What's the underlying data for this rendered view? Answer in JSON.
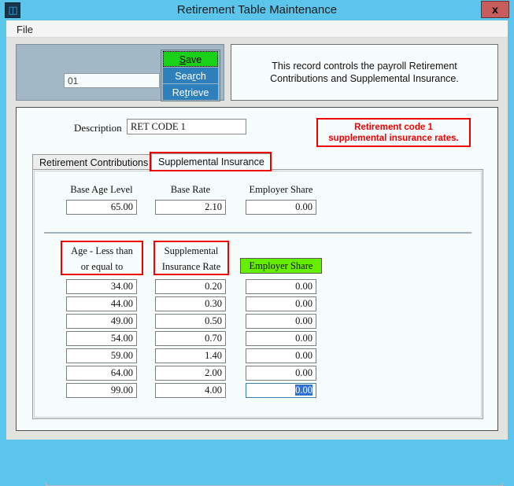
{
  "window": {
    "title": "Retirement Table Maintenance",
    "icon": "database-icon",
    "close_label": "x",
    "titlebar_color": "#5bc5ec"
  },
  "menubar": {
    "items": [
      {
        "label": "File"
      }
    ]
  },
  "toolbar": {
    "code_value": "01",
    "buttons": [
      {
        "label": "Save",
        "accel": "S",
        "color": "#18d118",
        "focused": true
      },
      {
        "label": "Search",
        "accel": "r",
        "color": "#2e80bd",
        "focused": false
      },
      {
        "label": "Retrieve",
        "accel": "t",
        "color": "#2e80bd",
        "focused": false
      }
    ]
  },
  "info_box": {
    "text": "This record controls the payroll Retirement\nContributions and Supplemental Insurance."
  },
  "form": {
    "description_label": "Description",
    "description_value": "RET CODE 1"
  },
  "annotation": {
    "text": "Retirement code 1\nsupplemental insurance rates.",
    "color": "#ee0000"
  },
  "tabs": [
    {
      "label": "Retirement Contributions",
      "selected": false
    },
    {
      "label": "Supplemental Insurance",
      "selected": true,
      "highlighted": true
    }
  ],
  "base_row": {
    "columns": [
      {
        "label": "Base Age Level",
        "value": "65.00"
      },
      {
        "label": "Base Rate",
        "value": "2.10"
      },
      {
        "label": "Employer Share",
        "value": "0.00"
      }
    ]
  },
  "table": {
    "headers": [
      {
        "label": "Age - Less than\nor equal to",
        "highlight": "red-box"
      },
      {
        "label": "Supplemental\nInsurance Rate",
        "highlight": "red-box"
      },
      {
        "label": "Employer Share",
        "highlight": "green-fill",
        "color": "#66ee00"
      }
    ],
    "rows": [
      {
        "age": "34.00",
        "rate": "0.20",
        "employer_share": "0.00",
        "focused": false
      },
      {
        "age": "44.00",
        "rate": "0.30",
        "employer_share": "0.00",
        "focused": false
      },
      {
        "age": "49.00",
        "rate": "0.50",
        "employer_share": "0.00",
        "focused": false
      },
      {
        "age": "54.00",
        "rate": "0.70",
        "employer_share": "0.00",
        "focused": false
      },
      {
        "age": "59.00",
        "rate": "1.40",
        "employer_share": "0.00",
        "focused": false
      },
      {
        "age": "64.00",
        "rate": "2.00",
        "employer_share": "0.00",
        "focused": false
      },
      {
        "age": "99.00",
        "rate": "4.00",
        "employer_share": "0.00",
        "focused": true
      }
    ]
  }
}
